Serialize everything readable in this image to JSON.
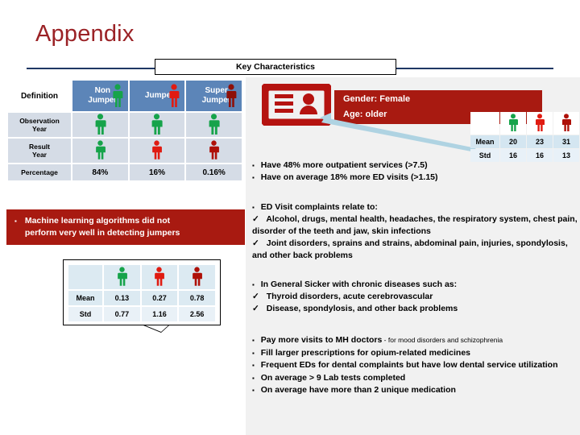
{
  "slide": {
    "title": "Appendix",
    "section_plate": "Key Characteristics",
    "accent_red": "#A81A11",
    "title_red": "#9B2226",
    "rule_navy": "#1F3864",
    "header_blue": "#5C85B8",
    "cell_blue": "#D5DCE6"
  },
  "definition_table": {
    "corner_label": "Definition",
    "columns": [
      {
        "label_line1": "Non",
        "label_line2": "Jumper",
        "icon": "person-green-icon"
      },
      {
        "label_line1": "Jumper",
        "label_line2": "",
        "icon": "person-red-icon"
      },
      {
        "label_line1": "Super",
        "label_line2": "Jumper",
        "icon": "person-darkred-icon"
      }
    ],
    "rows": [
      {
        "label_line1": "Observation",
        "label_line2": "Year",
        "cells": [
          "person-green-icon",
          "person-green-icon",
          "person-green-icon"
        ]
      },
      {
        "label_line1": "Result",
        "label_line2": "Year",
        "cells": [
          "person-green-icon",
          "person-red-icon",
          "person-darkred-icon"
        ]
      }
    ],
    "percentage_row": {
      "label": "Percentage",
      "values": [
        "84%",
        "16%",
        "0.16%"
      ]
    }
  },
  "red_banner_left": {
    "bullet": "▪",
    "line1": "Machine learning algorithms did not",
    "line2": "perform very well in detecting jumpers"
  },
  "lower_stats_table": {
    "column_icons": [
      "person-green-icon",
      "person-red-icon",
      "person-darkred-icon"
    ],
    "rows": [
      {
        "label": "Mean",
        "values": [
          "0.13",
          "0.27",
          "0.78"
        ]
      },
      {
        "label": "Std",
        "values": [
          "0.77",
          "1.16",
          "2.56"
        ]
      }
    ]
  },
  "id_card": {
    "icon": "id-card-icon"
  },
  "red_banner_right": {
    "line1": "Gender: Female",
    "line2": "Age: older"
  },
  "right_stats_table": {
    "column_icons": [
      "person-green-icon",
      "person-red-icon",
      "person-darkred-icon"
    ],
    "rows": [
      {
        "label": "Mean",
        "values": [
          "20",
          "23",
          "31"
        ]
      },
      {
        "label": "Std",
        "values": [
          "16",
          "16",
          "13"
        ]
      }
    ]
  },
  "text_blocks": {
    "utilization": {
      "items": [
        {
          "marker": "▪",
          "text": "Have 48% more outpatient services (>7.5)"
        },
        {
          "marker": "▪",
          "text": "Have on average 18% more ED visits (>1.15)"
        }
      ]
    },
    "ed_complaints": {
      "heading": {
        "marker": "▪",
        "text": "ED Visit complaints relate to:"
      },
      "items": [
        {
          "marker": "✓",
          "text": "Alcohol, drugs, mental health, headaches, the respiratory system, chest pain, disorder of the teeth and jaw, skin infections"
        },
        {
          "marker": "✓",
          "text": "Joint disorders, sprains and strains, abdominal pain, injuries, spondylosis, and other back problems"
        }
      ]
    },
    "chronic": {
      "heading": {
        "marker": "▪",
        "text": "In General Sicker with chronic diseases such as:"
      },
      "items": [
        {
          "marker": "✓",
          "text": "Thyroid disorders, acute cerebrovascular"
        },
        {
          "marker": "✓",
          "text": "Disease, spondylosis, and other back problems"
        }
      ]
    },
    "misc": {
      "items": [
        {
          "marker": "▪",
          "text": "Pay more visits to MH doctors",
          "suffix": " - for mood disorders and schizophrenia"
        },
        {
          "marker": "▪",
          "text": "Fill larger prescriptions for opium-related medicines",
          "suffix": ""
        },
        {
          "marker": "▪",
          "text": "Frequent EDs for dental complaints but have low dental service utilization",
          "suffix": ""
        },
        {
          "marker": "▪",
          "text": "On average > 9 Lab tests completed",
          "suffix": ""
        },
        {
          "marker": "▪",
          "text": "On average have more than 2 unique medication",
          "suffix": ""
        }
      ]
    }
  }
}
